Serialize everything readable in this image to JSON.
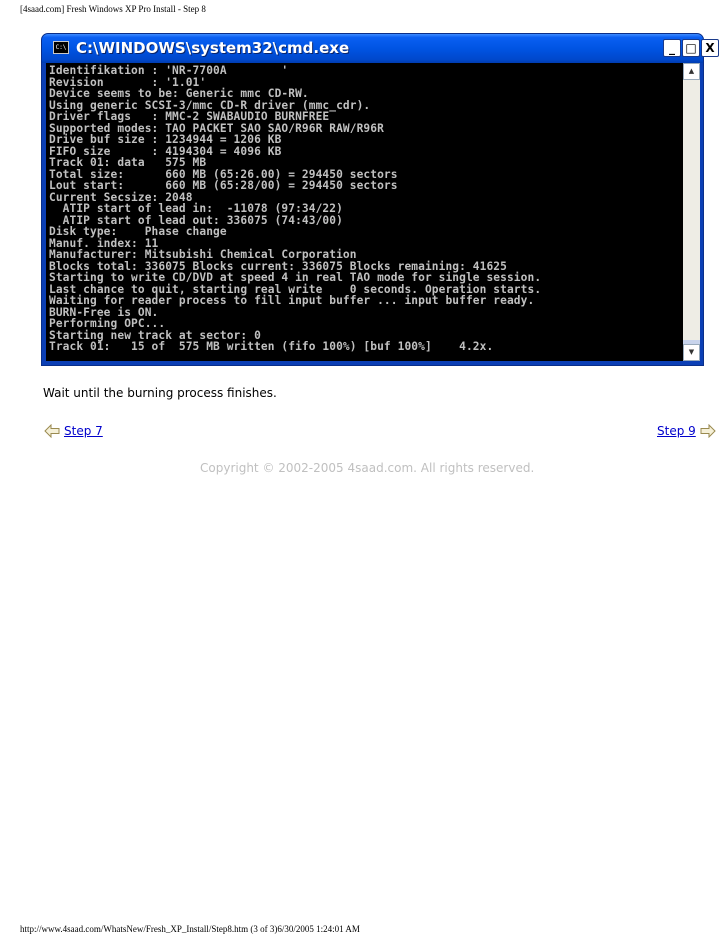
{
  "print_header": "[4saad.com] Fresh Windows XP Pro Install - Step 8",
  "window": {
    "icon_label": "C:\\",
    "title": "C:\\WINDOWS\\system32\\cmd.exe",
    "min_glyph": "_",
    "max_glyph": "□",
    "close_glyph": "X"
  },
  "console_lines": [
    "Identifikation : 'NR-7700A        '",
    "Revision       : '1.01'",
    "Device seems to be: Generic mmc CD-RW.",
    "Using generic SCSI-3/mmc CD-R driver (mmc_cdr).",
    "Driver flags   : MMC-2 SWABAUDIO BURNFREE",
    "Supported modes: TAO PACKET SAO SAO/R96R RAW/R96R",
    "Drive buf size : 1234944 = 1206 KB",
    "FIFO size      : 4194304 = 4096 KB",
    "Track 01: data   575 MB",
    "Total size:      660 MB (65:26.00) = 294450 sectors",
    "Lout start:      660 MB (65:28/00) = 294450 sectors",
    "Current Secsize: 2048",
    "  ATIP start of lead in:  -11078 (97:34/22)",
    "  ATIP start of lead out: 336075 (74:43/00)",
    "Disk type:    Phase change",
    "Manuf. index: 11",
    "Manufacturer: Mitsubishi Chemical Corporation",
    "Blocks total: 336075 Blocks current: 336075 Blocks remaining: 41625",
    "Starting to write CD/DVD at speed 4 in real TAO mode for single session.",
    "Last chance to quit, starting real write    0 seconds. Operation starts.",
    "Waiting for reader process to fill input buffer ... input buffer ready.",
    "BURN-Free is ON.",
    "Performing OPC...",
    "Starting new track at sector: 0",
    "Track 01:   15 of  575 MB written (fifo 100%) [buf 100%]    4.2x."
  ],
  "scrollbar": {
    "up_glyph": "▲",
    "down_glyph": "▼"
  },
  "instruction": "Wait until the burning process finishes.",
  "nav": {
    "prev_label": "Step 7",
    "next_label": "Step 9"
  },
  "copyright": "Copyright © 2002-2005 4saad.com. All rights reserved.",
  "print_footer": "http://www.4saad.com/WhatsNew/Fresh_XP_Install/Step8.htm (3 of 3)6/30/2005 1:24:01 AM",
  "colors": {
    "link": "#0000cc",
    "copyright": "#c0c0c0",
    "console_text": "#c0c0c0",
    "titlebar": "#0054e3"
  }
}
